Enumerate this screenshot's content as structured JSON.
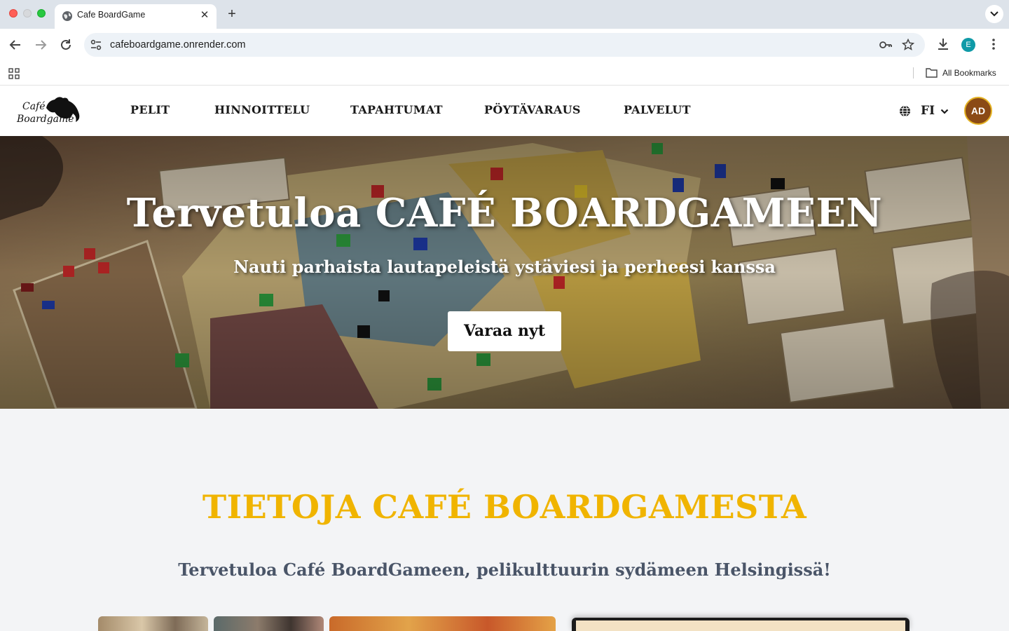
{
  "browser": {
    "tab_title": "Cafe BoardGame",
    "url": "cafeboardgame.onrender.com",
    "bookmarks_label": "All Bookmarks",
    "profile_initial": "E"
  },
  "site": {
    "logo_line1": "Café",
    "logo_line2": "Boardgame",
    "nav": [
      {
        "label": "PELIT"
      },
      {
        "label": "HINNOITTELU"
      },
      {
        "label": "TAPAHTUMAT"
      },
      {
        "label": "PÖYTÄVARAUS"
      },
      {
        "label": "PALVELUT"
      }
    ],
    "language": "FI",
    "user_initials": "AD"
  },
  "hero": {
    "title": "Tervetuloa CAFÉ BOARDGAMEEN",
    "subtitle": "Nauti parhaista lautapeleistä ystäviesi ja perheesi kanssa",
    "cta_label": "Varaa nyt"
  },
  "about": {
    "title": "TIETOJA CAFÉ BOARDGAMESTA",
    "subtitle": "Tervetuloa Café BoardGameen, pelikulttuurin sydämeen Helsingissä!"
  },
  "colors": {
    "accent": "#f0b400",
    "avatar_bg": "#8b4a15",
    "avatar_ring": "#e3b122",
    "subtitle_gray": "#4a5568"
  }
}
